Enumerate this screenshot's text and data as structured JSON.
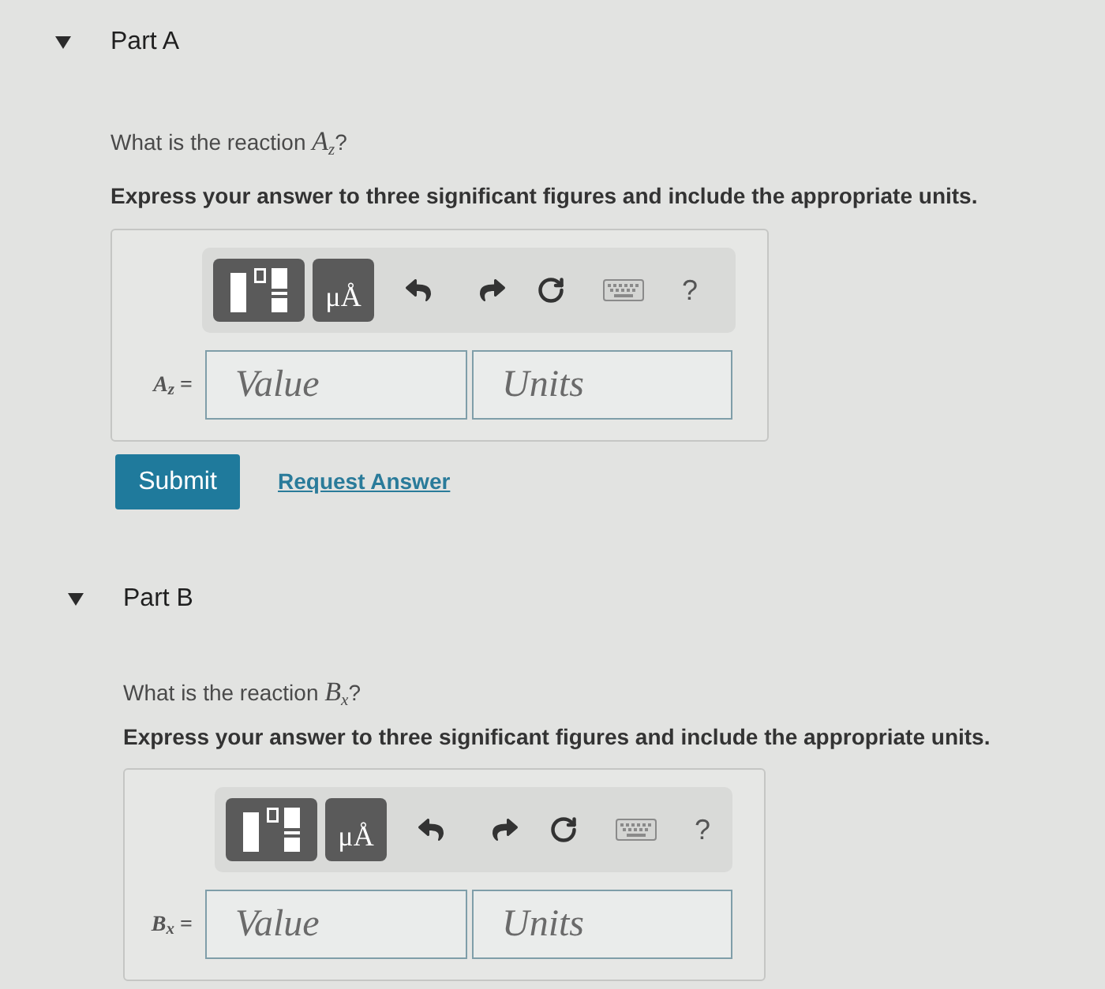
{
  "parts": [
    {
      "title": "Part A",
      "expanded": true,
      "question": "What is the reaction *A*$_{z}$?",
      "instruction": "Express your answer to three significant figures and include the appropriate units.",
      "toolbar": {
        "units_button": "μÅ",
        "help": "?"
      },
      "answer": {
        "label": "*A*$_{z}$ =",
        "value_placeholder": "Value",
        "units_placeholder": "Units"
      },
      "actions": {
        "submit": "Submit",
        "request_answer": "Request Answer"
      }
    },
    {
      "title": "Part B",
      "expanded": true,
      "question": "What is the reaction *B*$_{x}$?",
      "instruction": "Express your answer to three significant figures and include the appropriate units.",
      "toolbar": {
        "units_button": "μÅ",
        "help": "?"
      },
      "answer": {
        "label": "*B*$_{x}$ =",
        "value_placeholder": "Value",
        "units_placeholder": "Units"
      }
    }
  ]
}
